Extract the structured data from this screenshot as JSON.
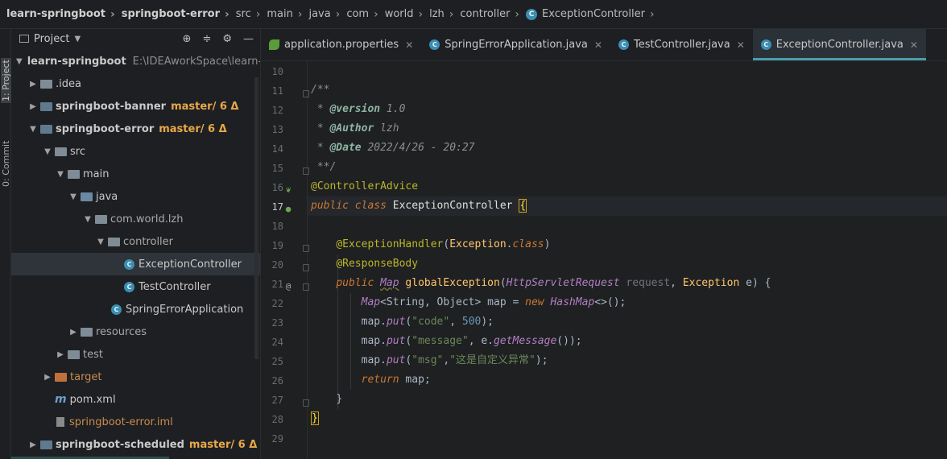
{
  "breadcrumb": {
    "items": [
      "learn-springboot",
      "springboot-error",
      "src",
      "main",
      "java",
      "com",
      "world",
      "lzh",
      "controller",
      "ExceptionController"
    ],
    "separator": "›"
  },
  "tool_strip": {
    "project_label": "1: Project",
    "commit_label": "0: Commit"
  },
  "project_panel": {
    "title": "Project",
    "tree": [
      {
        "name": "learn-springboot",
        "path": "E:\\IDEAworkSpace\\learn-s",
        "branch": ""
      },
      {
        "name": ".idea"
      },
      {
        "name": "springboot-banner",
        "branch": "master/ 6 Δ"
      },
      {
        "name": "springboot-error",
        "branch": "master/ 6 Δ"
      },
      {
        "name": "src"
      },
      {
        "name": "main"
      },
      {
        "name": "java"
      },
      {
        "name": "com.world.lzh"
      },
      {
        "name": "controller"
      },
      {
        "name": "ExceptionController"
      },
      {
        "name": "TestController"
      },
      {
        "name": "SpringErrorApplication"
      },
      {
        "name": "resources"
      },
      {
        "name": "test"
      },
      {
        "name": "target"
      },
      {
        "name": "pom.xml"
      },
      {
        "name": "springboot-error.iml"
      },
      {
        "name": "springboot-scheduled",
        "branch": "master/ 6 Δ"
      }
    ]
  },
  "tabs": [
    {
      "label": "application.properties",
      "active": false
    },
    {
      "label": "SpringErrorApplication.java",
      "active": false
    },
    {
      "label": "TestController.java",
      "active": false
    },
    {
      "label": "ExceptionController.java",
      "active": true
    }
  ],
  "editor": {
    "line_numbers": [
      "10",
      "11",
      "12",
      "13",
      "14",
      "15",
      "16",
      "17",
      "18",
      "19",
      "20",
      "21",
      "22",
      "23",
      "24",
      "25",
      "26",
      "27",
      "28",
      "29"
    ],
    "current_line": "17",
    "code": {
      "l11": "/**",
      "l12_tag": "@version",
      "l12_val": " 1.0",
      "l13_tag": "@Author",
      "l13_val": " lzh",
      "l14_tag": "@Date",
      "l14_val": " 2022/4/26 - 20:27",
      "l15": " **/",
      "l16": "@ControllerAdvice",
      "l17_kw1": "public",
      "l17_kw2": "class",
      "l17_name": "ExceptionController",
      "l17_brace": "{",
      "l19_ann": "@ExceptionHandler",
      "l19_open": "(",
      "l19_cls": "Exception",
      "l19_dot": ".",
      "l19_kw": "class",
      "l19_close": ")",
      "l20_ann": "@ResponseBody",
      "l21_kw": "public",
      "l21_type": "Map",
      "l21_fn": "globalException",
      "l21_p1type": "HttpServletRequest",
      "l21_p1": "request",
      "l21_p2type": "Exception",
      "l21_p2": "e",
      "l21_end": ") {",
      "l22_type": "Map",
      "l22_generic": "<String, Object>",
      "l22_var": " map = ",
      "l22_kw": "new",
      "l22_impl": "HashMap",
      "l22_end": "<>();",
      "l23_a": "map.",
      "l23_fn": "put",
      "l23_b": "(",
      "l23_str": "\"code\"",
      "l23_c": ", ",
      "l23_num": "500",
      "l23_d": ");",
      "l24_a": "map.",
      "l24_fn": "put",
      "l24_b": "(",
      "l24_str": "\"message\"",
      "l24_c": ", e.",
      "l24_fn2": "getMessage",
      "l24_d": "());",
      "l25_a": "map.",
      "l25_fn": "put",
      "l25_b": "(",
      "l25_str1": "\"msg\"",
      "l25_c": ",",
      "l25_str2": "\"这是自定义异常\"",
      "l25_d": ");",
      "l26_kw": "return",
      "l26_rest": " map;",
      "l27": "}",
      "l28": "}"
    }
  },
  "colors": {
    "background": "#1f2022",
    "keyword": "#cc7832",
    "annotation": "#bbb529",
    "string": "#6a8759",
    "number": "#6897bb",
    "method": "#ffc66d",
    "active_tab_underline": "#4a9dab",
    "branch": "#e8a848"
  }
}
